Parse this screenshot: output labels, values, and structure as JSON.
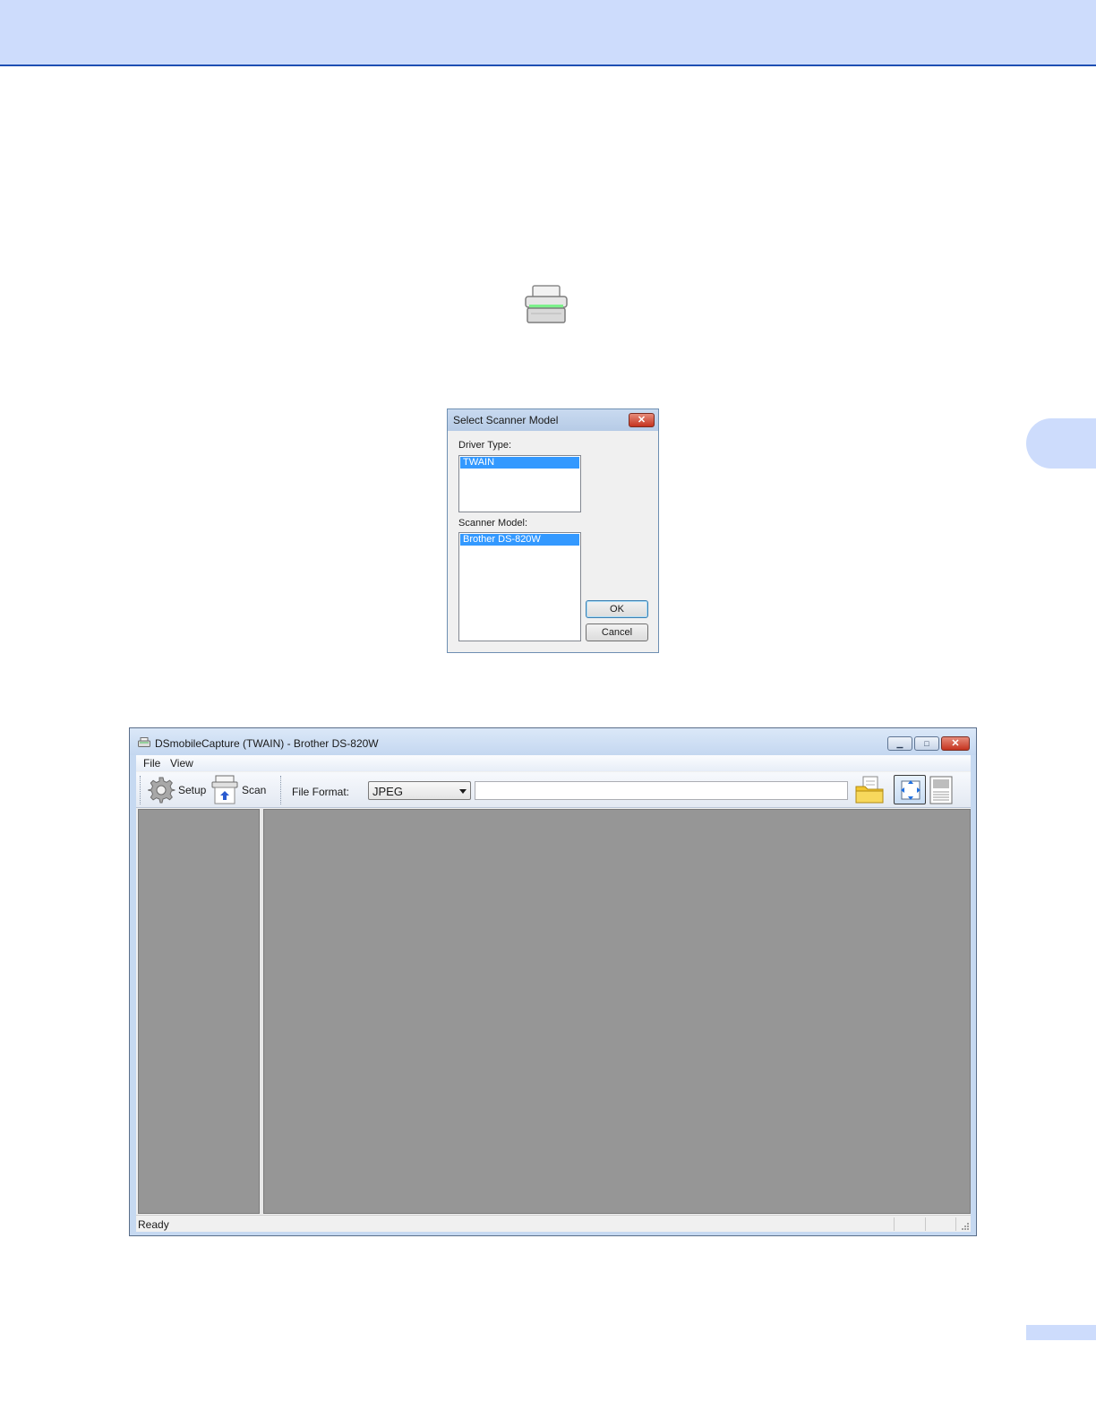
{
  "dialog": {
    "title": "Select Scanner Model",
    "driver_type_label": "Driver Type:",
    "driver_types": [
      "TWAIN"
    ],
    "selected_driver": "TWAIN",
    "scanner_model_label": "Scanner Model:",
    "scanner_models": [
      "Brother DS-820W"
    ],
    "selected_model": "Brother DS-820W",
    "ok_label": "OK",
    "cancel_label": "Cancel"
  },
  "app": {
    "title": "DSmobileCapture (TWAIN) - Brother DS-820W",
    "menu": [
      "File",
      "View"
    ],
    "toolbar": {
      "setup_label": "Setup",
      "scan_label": "Scan",
      "file_format_label": "File Format:",
      "file_format_value": "JPEG",
      "file_path_value": ""
    },
    "status": "Ready"
  },
  "colors": {
    "header_band": "#cddcfc",
    "header_rule": "#1e4fb3",
    "selection": "#3399ff",
    "pane_gray": "#969696"
  }
}
